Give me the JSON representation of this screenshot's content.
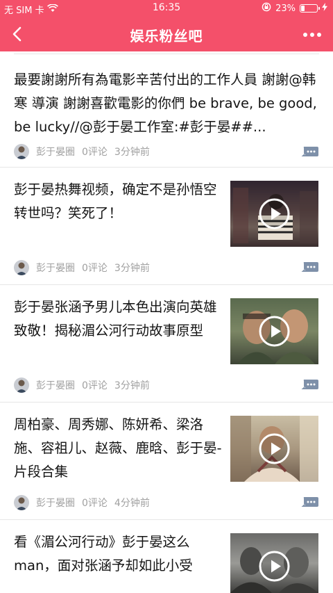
{
  "status_bar": {
    "carrier": "无 SIM 卡",
    "time": "16:35",
    "battery_percent": "23%",
    "battery_level": 0.23
  },
  "nav": {
    "title": "娱乐粉丝吧",
    "back_icon": "back-chevron-icon",
    "more_icon": "more-dots-icon"
  },
  "feed": [
    {
      "headline": "最要謝謝所有為電影辛苦付出的工作人員 謝謝@韩寒 導演 謝謝喜歡電影的你們 be brave, be good, be lucky//@彭于晏工作室:#彭于晏##...",
      "author": "彭于晏圈",
      "comments": "0评论",
      "time": "3分钟前",
      "has_thumb": false
    },
    {
      "headline": "彭于晏热舞视频，确定不是孙悟空转世吗？笑死了！",
      "author": "彭于晏圈",
      "comments": "0评论",
      "time": "3分钟前",
      "has_thumb": true
    },
    {
      "headline": "彭于晏张涵予男儿本色出演向英雄致敬！揭秘湄公河行动故事原型",
      "author": "彭于晏圈",
      "comments": "0评论",
      "time": "3分钟前",
      "has_thumb": true
    },
    {
      "headline": "周柏豪、周秀娜、陈妍希、梁洛施、容祖儿、赵薇、鹿晗、彭于晏-片段合集",
      "author": "彭于晏圈",
      "comments": "0评论",
      "time": "4分钟前",
      "has_thumb": true
    },
    {
      "headline": "看《湄公河行动》彭于晏这么man，面对张涵予却如此小受",
      "author": "",
      "comments": "",
      "time": "",
      "has_thumb": true
    }
  ],
  "colors": {
    "brand": "#f4506a",
    "meta_text": "#a0a0a0",
    "divider": "#e6e6e6"
  }
}
